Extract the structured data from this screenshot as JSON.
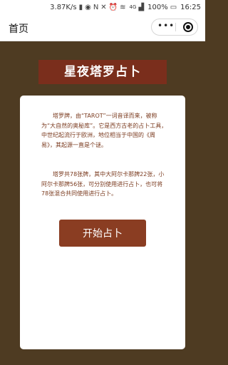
{
  "status_bar": {
    "speed": "3.87K/s",
    "network": "4G",
    "battery": "100%",
    "time": "16:25"
  },
  "nav": {
    "title": "首页",
    "more_label": "•••"
  },
  "banner": {
    "title": "星夜塔罗占卜"
  },
  "card": {
    "paragraph1": "塔罗牌，由“TAROT”一词音译而来，被称为“大自然的奥秘库”。它是西方古老的占卜工具，中世纪起流行于欧洲，地位相当于中国的《周易》，其起源一直是个谜。",
    "paragraph2": "塔罗共78张牌，其中大阿尔卡那牌22张，小阿尔卡那牌56张，可分别使用进行占卜，也可将78张混合共同使用进行占卜。",
    "start_button": "开始占卜"
  },
  "colors": {
    "background": "#4e3b22",
    "banner": "#7a2e1c",
    "button": "#8a3d22",
    "text": "#7a3a1e"
  }
}
